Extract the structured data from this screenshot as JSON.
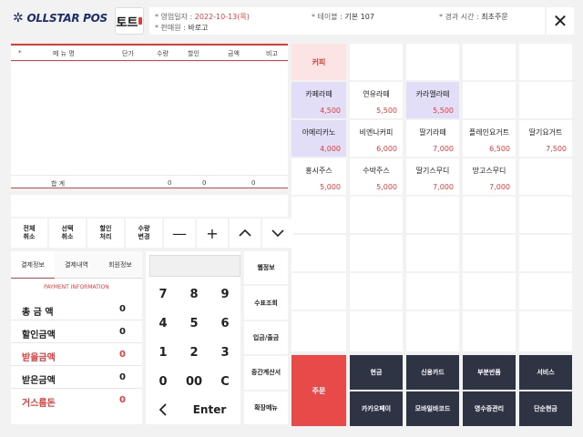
{
  "header": {
    "logo_text": "OLLSTAR POS",
    "brand_text": "토트",
    "business_date_label": "* 영업일자 :",
    "business_date_value": "2022-10-13(목)",
    "staff_label": "* 판매원 :",
    "staff_value": "바로고",
    "table_label": "* 테이블 :",
    "table_value": "기본 107",
    "elapsed_label": "* 경과 시간 :",
    "elapsed_value": "최초주문",
    "close_icon": "close-icon"
  },
  "order": {
    "columns": [
      "*",
      "메 뉴 명",
      "단가",
      "수량",
      "할인",
      "금액",
      "비고"
    ],
    "total_label": "합    계",
    "total_qty": "0",
    "total_discount": "0",
    "total_amount": "0"
  },
  "controls": {
    "buttons": [
      "전체\n취소",
      "선택\n취소",
      "할인\n처리",
      "수량\n변경"
    ],
    "minus": "—",
    "plus": "+",
    "up": "︿",
    "down": "﹀"
  },
  "payment": {
    "tabs": [
      "결제정보",
      "결제내역",
      "회원정보"
    ],
    "info_title": "PAYMENT INFORMATION",
    "rows": [
      {
        "label": "총 금 액",
        "value": "0"
      },
      {
        "label": "할인금액",
        "value": "0"
      },
      {
        "label": "받을금액",
        "value": "0"
      },
      {
        "label": "받은금액",
        "value": "0"
      },
      {
        "label": "거스름돈",
        "value": "0"
      }
    ]
  },
  "keypad": {
    "keys": [
      "7",
      "8",
      "9",
      "4",
      "5",
      "6",
      "1",
      "2",
      "3",
      "0",
      "00",
      "C"
    ],
    "back": "<",
    "enter": "Enter"
  },
  "side_buttons": [
    "웹정보",
    "수표조회",
    "입금/출금",
    "중간계산서",
    "확장메뉴"
  ],
  "menu": {
    "category": "커피",
    "items": [
      {
        "name": "카페라떼",
        "price": "4,500"
      },
      {
        "name": "연유라떼",
        "price": "5,500"
      },
      {
        "name": "카라멜라떼",
        "price": "5,500"
      },
      {
        "name": "아메리카노",
        "price": "4,000"
      },
      {
        "name": "비엔나커피",
        "price": "6,000"
      },
      {
        "name": "딸기라떼",
        "price": "7,000"
      },
      {
        "name": "플레인요거트",
        "price": "6,500"
      },
      {
        "name": "딸기요거트",
        "price": "7,500"
      },
      {
        "name": "홍시주스",
        "price": "5,000"
      },
      {
        "name": "수박주스",
        "price": "5,000"
      },
      {
        "name": "딸기스무디",
        "price": "7,000"
      },
      {
        "name": "망고스무디",
        "price": "7,000"
      }
    ]
  },
  "actions": {
    "order": "주문",
    "row1": [
      "현금",
      "신용카드",
      "부분반품",
      "서비스"
    ],
    "row2": [
      "카카오페이",
      "모바일바코드",
      "영수증관리",
      "단순현금"
    ]
  },
  "colors": {
    "accent": "#e23b3b",
    "highlight": "#e2def7",
    "action": "#2f3445"
  }
}
